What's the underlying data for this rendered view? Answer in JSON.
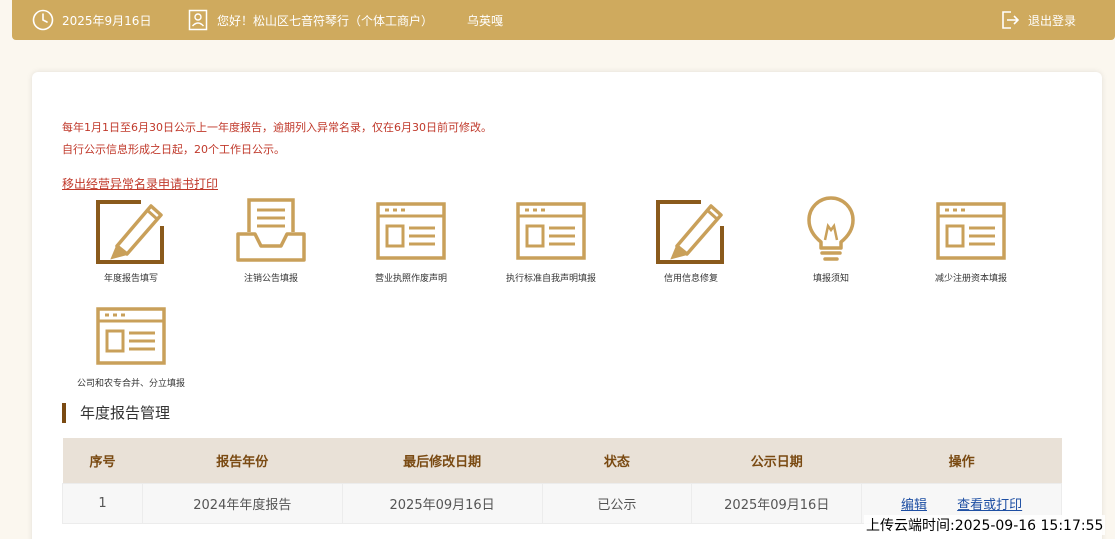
{
  "topbar": {
    "date": "2025年9月16日",
    "greeting": "您好！松山区七音符琴行（个体工商户）",
    "user": "乌英嘎",
    "logout_label": "退出登录"
  },
  "notice": {
    "line1": "每年1月1日至6月30日公示上一年度报告，逾期列入异常名录，仅在6月30日前可修改。",
    "line2": "自行公示信息形成之日起，20个工作日公示。",
    "remove_link": "移出经营异常名录申请书打印"
  },
  "tiles": [
    {
      "label": "年度报告填写",
      "icon": "edit-icon"
    },
    {
      "label": "注销公告填报",
      "icon": "inbox-tray-icon"
    },
    {
      "label": "营业执照作废声明",
      "icon": "form-window-icon"
    },
    {
      "label": "执行标准自我声明填报",
      "icon": "form-window-icon"
    },
    {
      "label": "信用信息修复",
      "icon": "edit-icon"
    },
    {
      "label": "填报须知",
      "icon": "lightbulb-icon"
    },
    {
      "label": "减少注册资本填报",
      "icon": "form-window-icon"
    },
    {
      "label": "公司和农专合并、分立填报",
      "icon": "form-window-icon"
    }
  ],
  "section": {
    "title": "年度报告管理"
  },
  "table": {
    "headers": [
      "序号",
      "报告年份",
      "最后修改日期",
      "状态",
      "公示日期",
      "操作"
    ],
    "rows": [
      {
        "no": "1",
        "year": "2024年年度报告",
        "modified": "2025年09月16日",
        "status": "已公示",
        "published": "2025年09月16日",
        "edit": "编辑",
        "view": "查看或打印"
      }
    ]
  },
  "timestamp": "上传云端时间:2025-09-16 15:17:55",
  "colors": {
    "gold": "#cfaa5e",
    "icon_gold": "#c9a05a",
    "icon_brown": "#8a5a1c",
    "notice_red": "#c0392b",
    "link_blue": "#1e4fa3",
    "header_bg": "#e9e1d7"
  }
}
